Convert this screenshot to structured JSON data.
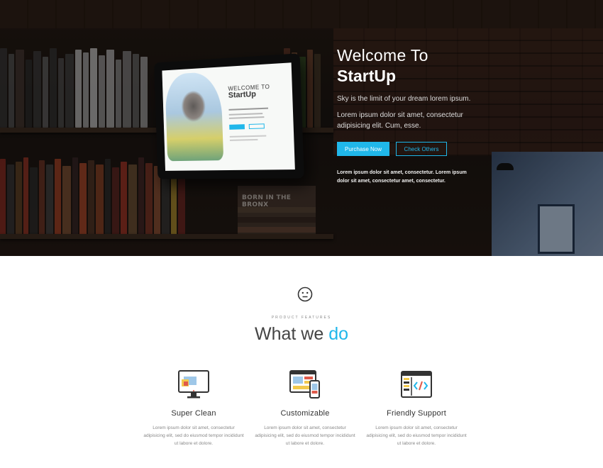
{
  "hero": {
    "title_line1": "Welcome To",
    "title_line2": "StartUp",
    "tagline": "Sky is the limit of your dream lorem ipsum.",
    "paragraph": "Lorem ipsum dolor sit amet, consectetur adipisicing elit. Cum, esse.",
    "primary_button": "Purchase Now",
    "secondary_button": "Check Others",
    "small_text": "Lorem ipsum dolor sit amet, consectetur. Lorem ipsum dolor sit amet, consectetur amet, consectetur.",
    "tablet_screen": {
      "title_line1": "WELCOME TO",
      "title_line2": "StartUp"
    },
    "book_titles": [
      "BORN IN THE BRONX"
    ]
  },
  "features": {
    "eyebrow": "PRODUCT FEATURES",
    "title_main": "What we ",
    "title_accent": "do",
    "items": [
      {
        "icon": "monitor-icon",
        "title": "Super Clean",
        "text": "Lorem ipsum dolor sit amet, consectetur adipisicing elit, sed do eiusmod tempor incididunt ut labore et dolore."
      },
      {
        "icon": "devices-icon",
        "title": "Customizable",
        "text": "Lorem ipsum dolor sit amet, consectetur adipisicing elit, sed do eiusmod tempor incididunt ut labore et dolore."
      },
      {
        "icon": "code-window-icon",
        "title": "Friendly Support",
        "text": "Lorem ipsum dolor sit amet, consectetur adipisicing elit, sed do eiusmod tempor incididunt ut labore et dolore."
      }
    ]
  },
  "colors": {
    "accent": "#20b7ea",
    "hero_bg": "#1a1411",
    "text_dark": "#444444"
  }
}
